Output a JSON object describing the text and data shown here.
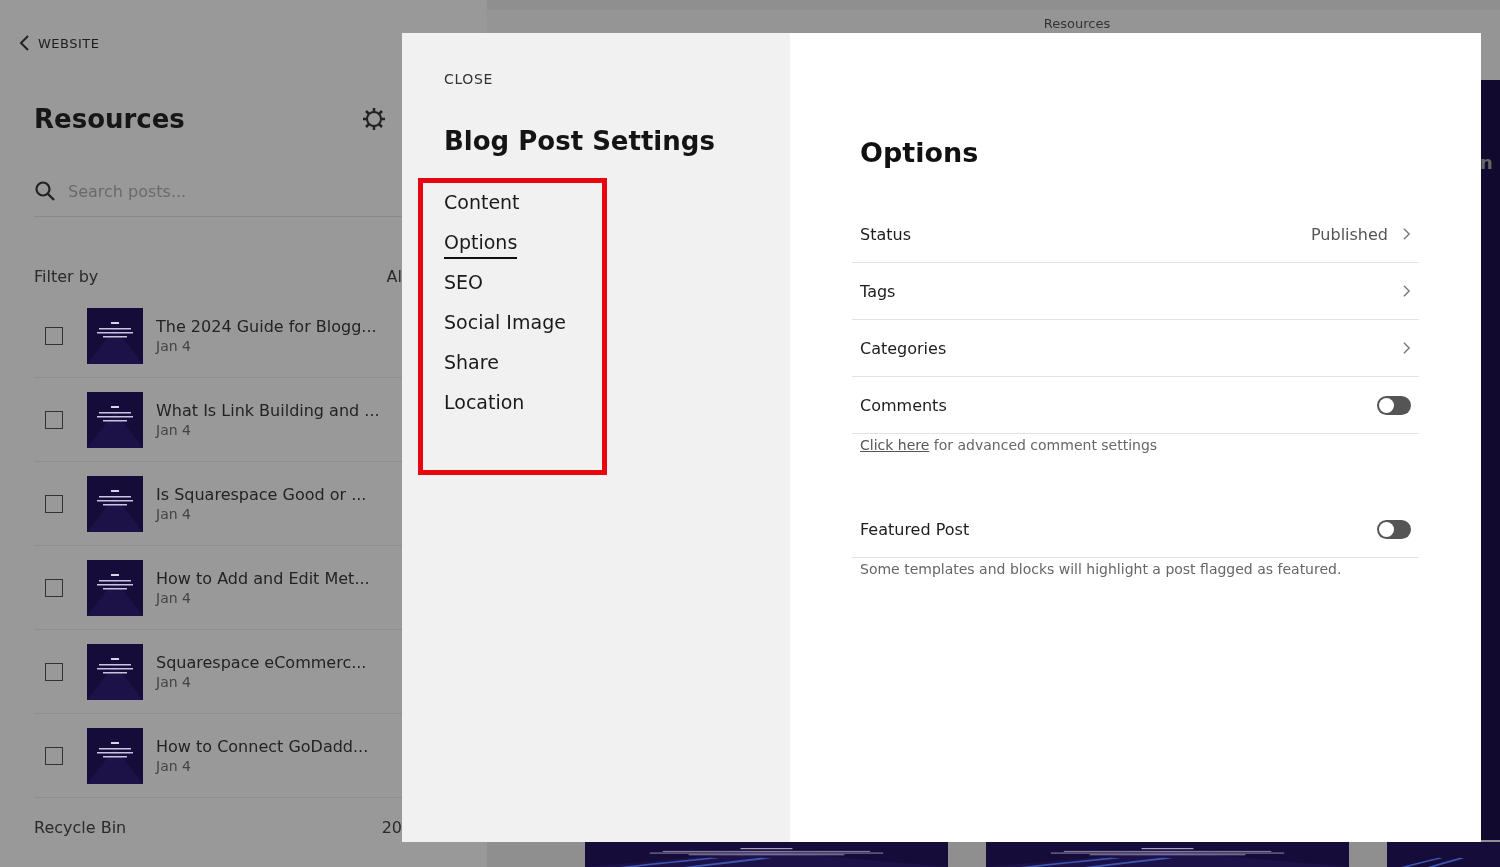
{
  "sidebar": {
    "back_link": "WEBSITE",
    "title": "Resources",
    "search": {
      "placeholder": "Search posts..."
    },
    "filter_label": "Filter by",
    "filter_value": "Al",
    "posts": [
      {
        "title": "The 2024 Guide for Blogg...",
        "date": "Jan 4",
        "checked": false
      },
      {
        "title": "What Is Link Building and ...",
        "date": "Jan 4",
        "checked": false
      },
      {
        "title": "Is Squarespace Good or ...",
        "date": "Jan 4",
        "checked": false
      },
      {
        "title": "How to Add and Edit Met...",
        "date": "Jan 4",
        "checked": false
      },
      {
        "title": "Squarespace eCommerc...",
        "date": "Jan 4",
        "checked": false
      },
      {
        "title": "How to Connect GoDadd...",
        "date": "Jan 4",
        "checked": false
      }
    ],
    "recycle_bin": "Recycle Bin",
    "recycle_count": "20"
  },
  "preview": {
    "title": "Resources",
    "side_letter": "n"
  },
  "modal": {
    "close": "CLOSE",
    "title": "Blog Post Settings",
    "nav": [
      {
        "label": "Content",
        "selected": false
      },
      {
        "label": "Options",
        "selected": true
      },
      {
        "label": "SEO",
        "selected": false
      },
      {
        "label": "Social Image",
        "selected": false
      },
      {
        "label": "Share",
        "selected": false
      },
      {
        "label": "Location",
        "selected": false
      }
    ],
    "heading": "Options",
    "rows": [
      {
        "kind": "link",
        "label": "Status",
        "value": "Published"
      },
      {
        "kind": "link",
        "label": "Tags"
      },
      {
        "kind": "link",
        "label": "Categories"
      },
      {
        "kind": "toggle",
        "label": "Comments",
        "on": false,
        "note_link": "Click here",
        "note": " for advanced comment settings"
      },
      {
        "kind": "toggle",
        "label": "Featured Post",
        "on": false,
        "note": "Some templates and blocks will highlight a post flagged as featured."
      }
    ]
  }
}
